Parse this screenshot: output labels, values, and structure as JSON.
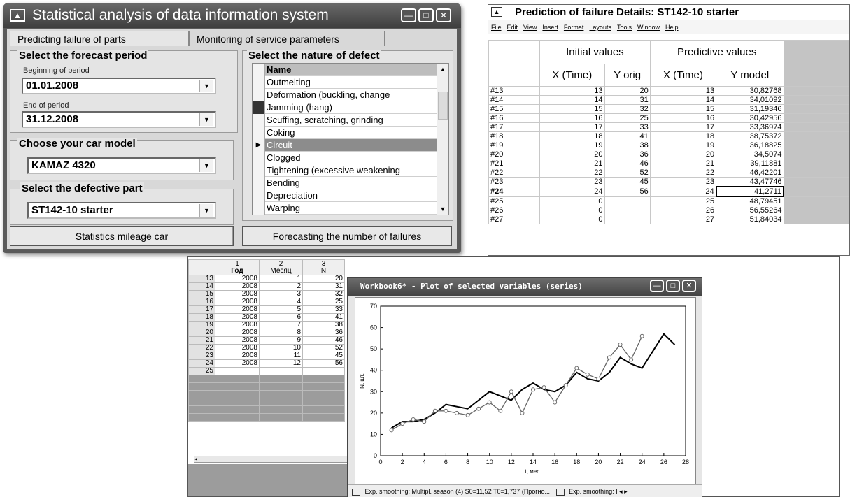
{
  "window1": {
    "title": "Statistical analysis of data information system",
    "tabs": [
      "Predicting failure of parts",
      "Monitoring of service parameters"
    ],
    "forecast_group_title": "Select the forecast period",
    "beginning_label": "Beginning of period",
    "beginning_value": "01.01.2008",
    "end_label": "End of period",
    "end_value": "31.12.2008",
    "car_group_title": "Choose your car model",
    "car_value": "KAMAZ 4320",
    "part_group_title": "Select the defective part",
    "part_value": "ST142-10 starter",
    "defect_group_title": "Select the nature of defect",
    "defect_header": "Name",
    "defects": [
      "Outmelting",
      "Deformation (buckling, change",
      "Jamming (hang)",
      "Scuffing, scratching, grinding",
      "Coking",
      "Circuit",
      "Clogged",
      "Tightening (excessive weakening",
      "Bending",
      "Depreciation",
      "Warping"
    ],
    "selected_defect": "Circuit",
    "button_stats": "Statistics mileage car",
    "button_forecast": "Forecasting the number of failures"
  },
  "window2": {
    "title": "Prediction of failure Details: ST142-10 starter",
    "menu": [
      "File",
      "Edit",
      "View",
      "Insert",
      "Format",
      "Layouts",
      "Tools",
      "Window",
      "Help"
    ],
    "group_initial": "Initial values",
    "group_predictive": "Predictive values",
    "col_x_time": "X (Time)",
    "col_y_orig": "Y orig",
    "col_x_time2": "X (Time)",
    "col_y_model": "Y model",
    "rows": [
      {
        "id": "#13",
        "x": "13",
        "y": "20",
        "x2": "13",
        "ym": "30,82768"
      },
      {
        "id": "#14",
        "x": "14",
        "y": "31",
        "x2": "14",
        "ym": "34,01092"
      },
      {
        "id": "#15",
        "x": "15",
        "y": "32",
        "x2": "15",
        "ym": "31,19346"
      },
      {
        "id": "#16",
        "x": "16",
        "y": "25",
        "x2": "16",
        "ym": "30,42956"
      },
      {
        "id": "#17",
        "x": "17",
        "y": "33",
        "x2": "17",
        "ym": "33,36974"
      },
      {
        "id": "#18",
        "x": "18",
        "y": "41",
        "x2": "18",
        "ym": "38,75372"
      },
      {
        "id": "#19",
        "x": "19",
        "y": "38",
        "x2": "19",
        "ym": "36,18825"
      },
      {
        "id": "#20",
        "x": "20",
        "y": "36",
        "x2": "20",
        "ym": "34,5074"
      },
      {
        "id": "#21",
        "x": "21",
        "y": "46",
        "x2": "21",
        "ym": "39,11881"
      },
      {
        "id": "#22",
        "x": "22",
        "y": "52",
        "x2": "22",
        "ym": "46,42201"
      },
      {
        "id": "#23",
        "x": "23",
        "y": "45",
        "x2": "23",
        "ym": "43,47746"
      },
      {
        "id": "#24",
        "x": "24",
        "y": "56",
        "x2": "24",
        "ym": "41,2711"
      },
      {
        "id": "#25",
        "x": "0",
        "y": "",
        "x2": "25",
        "ym": "48,79451"
      },
      {
        "id": "#26",
        "x": "0",
        "y": "",
        "x2": "26",
        "ym": "56,55264"
      },
      {
        "id": "#27",
        "x": "0",
        "y": "",
        "x2": "27",
        "ym": "51,84034"
      }
    ]
  },
  "sheet": {
    "col_numbers": [
      "1",
      "2",
      "3"
    ],
    "col_names": [
      "Год",
      "Месяц",
      "N"
    ],
    "rows": [
      {
        "r": "13",
        "year": "2008",
        "month": "1",
        "n": "20"
      },
      {
        "r": "14",
        "year": "2008",
        "month": "2",
        "n": "31"
      },
      {
        "r": "15",
        "year": "2008",
        "month": "3",
        "n": "32"
      },
      {
        "r": "16",
        "year": "2008",
        "month": "4",
        "n": "25"
      },
      {
        "r": "17",
        "year": "2008",
        "month": "5",
        "n": "33"
      },
      {
        "r": "18",
        "year": "2008",
        "month": "6",
        "n": "41"
      },
      {
        "r": "19",
        "year": "2008",
        "month": "7",
        "n": "38"
      },
      {
        "r": "20",
        "year": "2008",
        "month": "8",
        "n": "36"
      },
      {
        "r": "21",
        "year": "2008",
        "month": "9",
        "n": "46"
      },
      {
        "r": "22",
        "year": "2008",
        "month": "10",
        "n": "52"
      },
      {
        "r": "23",
        "year": "2008",
        "month": "11",
        "n": "45"
      },
      {
        "r": "24",
        "year": "2008",
        "month": "12",
        "n": "56"
      },
      {
        "r": "25",
        "year": "",
        "month": "",
        "n": ""
      }
    ]
  },
  "plot_window": {
    "title": "Workbook6* - Plot of selected variables (series)",
    "status_1": "Exp. smoothing: Multipl. season (4) S0=11,52 T0=1,737 (Прогно...",
    "status_2": "Exp. smoothing: I"
  },
  "chart_data": {
    "type": "line",
    "title": "",
    "xlabel": "t, мес.",
    "ylabel": "N, шт.",
    "xlim": [
      0,
      28
    ],
    "ylim": [
      0,
      70
    ],
    "xticks": [
      0,
      2,
      4,
      6,
      8,
      10,
      12,
      14,
      16,
      18,
      20,
      22,
      24,
      26,
      28
    ],
    "yticks": [
      0,
      10,
      20,
      30,
      40,
      50,
      60,
      70
    ],
    "grid": false,
    "series": [
      {
        "color": "#000000",
        "marker": "none",
        "x": [
          1,
          2,
          3,
          4,
          5,
          6,
          7,
          8,
          9,
          10,
          11,
          12,
          13,
          14,
          15,
          16,
          17,
          18,
          19,
          20,
          21,
          22,
          23,
          24,
          25,
          26,
          27
        ],
        "y": [
          13,
          16,
          16,
          17,
          20,
          24,
          23,
          22,
          26,
          30,
          28,
          26,
          31,
          34,
          31,
          30,
          33,
          39,
          36,
          35,
          39,
          46,
          43,
          41,
          49,
          57,
          52
        ]
      },
      {
        "color": "#666666",
        "marker": "circle",
        "x": [
          1,
          2,
          3,
          4,
          5,
          6,
          7,
          8,
          9,
          10,
          11,
          12,
          13,
          14,
          15,
          16,
          17,
          18,
          19,
          20,
          21,
          22,
          23,
          24
        ],
        "y": [
          12,
          15,
          17,
          16,
          21,
          21,
          20,
          19,
          22,
          25,
          21,
          30,
          20,
          31,
          32,
          25,
          33,
          41,
          38,
          36,
          46,
          52,
          45,
          56
        ]
      }
    ]
  }
}
